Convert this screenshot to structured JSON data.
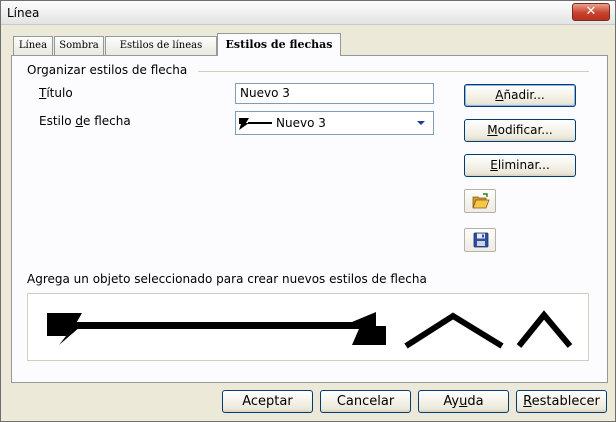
{
  "window": {
    "title": "Línea",
    "close_glyph": "✕"
  },
  "tabs": [
    {
      "label": "Línea"
    },
    {
      "label": "Sombra"
    },
    {
      "label": "Estilos de líneas"
    },
    {
      "label": "Estilos de flechas"
    }
  ],
  "group": {
    "title": "Organizar estilos de flecha",
    "title_field": {
      "label_first": "T",
      "label_rest": "ítulo",
      "value": "Nuevo 3"
    },
    "style_field": {
      "label_pre": "Estilo ",
      "label_u": "d",
      "label_post": "e flecha",
      "value": "Nuevo 3"
    }
  },
  "side_buttons": {
    "add": {
      "u": "A",
      "rest": "ñadir..."
    },
    "modify": {
      "u": "M",
      "rest": "odificar..."
    },
    "delete": {
      "u": "E",
      "rest": "liminar..."
    },
    "load_icon": "folder-open-icon",
    "save_icon": "floppy-disk-icon"
  },
  "hint": "Agrega un objeto seleccionado para crear nuevos estilos de flecha",
  "footer": {
    "ok": "Aceptar",
    "cancel": "Cancelar",
    "help_pre": "Ay",
    "help_u": "u",
    "help_post": "da",
    "reset_u": "R",
    "reset_rest": "establecer"
  },
  "colors": {
    "accent": "#1c3a94",
    "close": "#c8432d"
  }
}
